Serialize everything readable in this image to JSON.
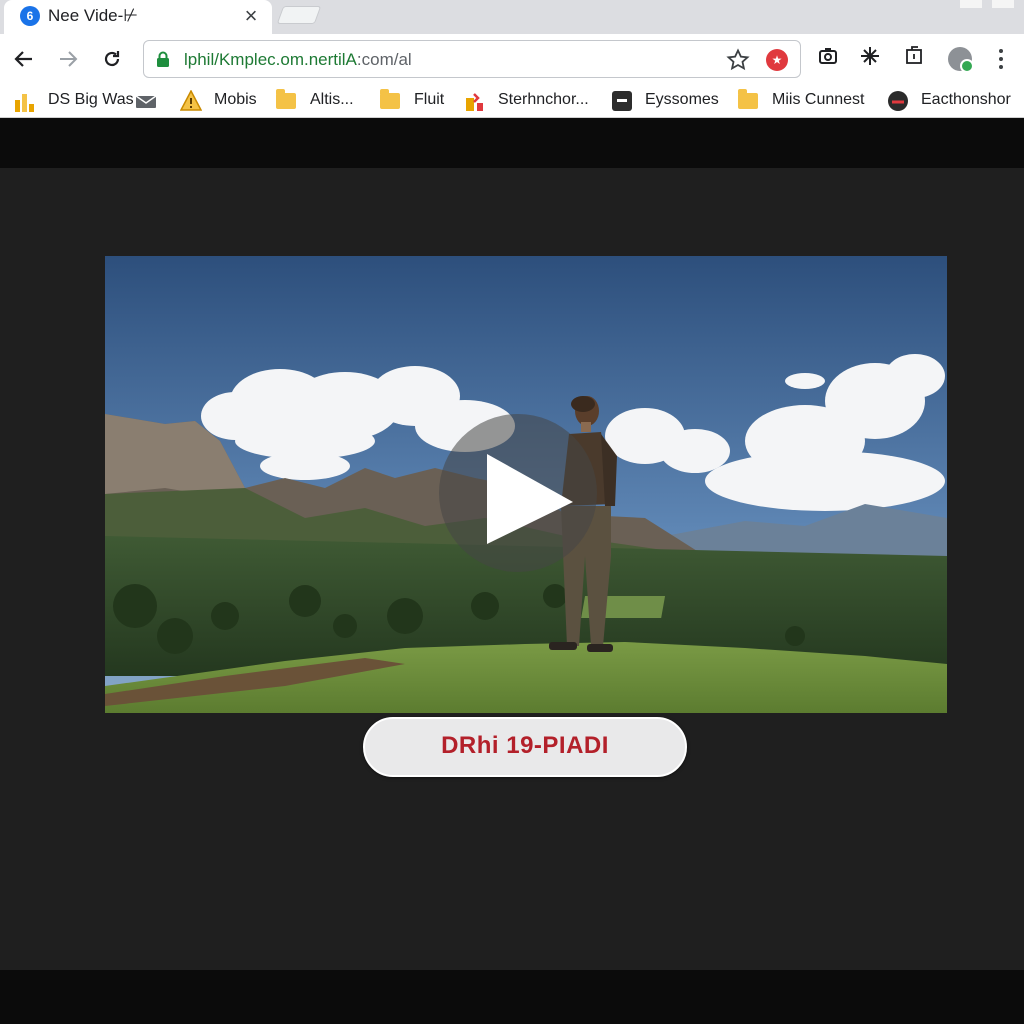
{
  "tab": {
    "title": "Nee Vide-⊬",
    "favicon": "6",
    "close": "×"
  },
  "address_bar": {
    "host": "lphil/Kmplec.om.nertilA",
    "path": ":com/al"
  },
  "toolbar": {
    "profile_status_color": "#34a853"
  },
  "bookmarks": [
    {
      "label": "DS Big Was",
      "icon": "chart-bars-icon"
    },
    {
      "label": "Mobis",
      "icon": "warning-icon"
    },
    {
      "label": "Altis...",
      "icon": "folder-icon"
    },
    {
      "label": "Fluit",
      "icon": "folder-icon"
    },
    {
      "label": "Sterhnchor...",
      "icon": "bookmark-app-icon"
    },
    {
      "label": "Eyssomes",
      "icon": "document-icon"
    },
    {
      "label": "Miis Cunnest",
      "icon": "folder-icon"
    },
    {
      "label": "Eacthonshor",
      "icon": "circle-app-icon"
    }
  ],
  "player": {
    "state": "paused"
  },
  "cta": {
    "label": "DRhi 19-PIADI"
  },
  "colors": {
    "cta_text": "#b3202a",
    "page_bg": "#1f1f1f",
    "url_host": "#1e7a34"
  }
}
